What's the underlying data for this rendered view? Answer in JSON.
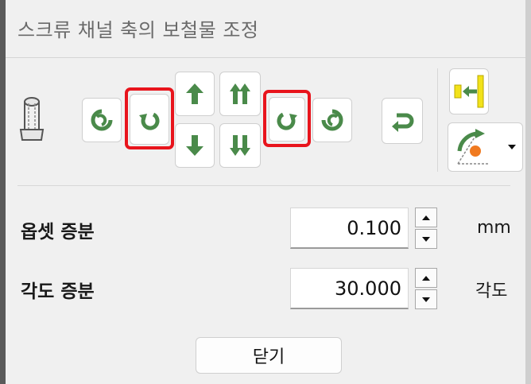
{
  "window": {
    "title": "스크류 채널 축의 보철물 조정"
  },
  "toolbar": {
    "screw_icon": "screw-channel-icon",
    "buttons": [
      {
        "name": "rotate-ccw-large-button",
        "icon": "rotate-ccw-large-icon"
      },
      {
        "name": "rotate-ccw-button",
        "icon": "rotate-ccw-icon",
        "highlighted": true
      },
      {
        "name": "move-up-button",
        "icon": "arrow-up-icon"
      },
      {
        "name": "move-down-button",
        "icon": "arrow-down-icon"
      },
      {
        "name": "spread-up-button",
        "icon": "double-arrow-up-icon"
      },
      {
        "name": "spread-down-button",
        "icon": "double-arrow-down-icon"
      },
      {
        "name": "rotate-cw-button",
        "icon": "rotate-cw-icon",
        "highlighted": true
      },
      {
        "name": "rotate-cw-large-button",
        "icon": "rotate-cw-large-icon"
      },
      {
        "name": "reset-button",
        "icon": "return-arrow-icon"
      },
      {
        "name": "align-button",
        "icon": "align-to-bar-icon"
      },
      {
        "name": "angle-mode-dropdown",
        "icon": "angle-arc-icon"
      }
    ],
    "highlight_color": "#e8141c",
    "icon_color": "#4a8a4a"
  },
  "offset": {
    "label": "옵셋 증분",
    "value": "0.100",
    "unit": "mm"
  },
  "angle": {
    "label": "각도 증분",
    "value": "30.000",
    "unit": "각도"
  },
  "close_label": "닫기"
}
